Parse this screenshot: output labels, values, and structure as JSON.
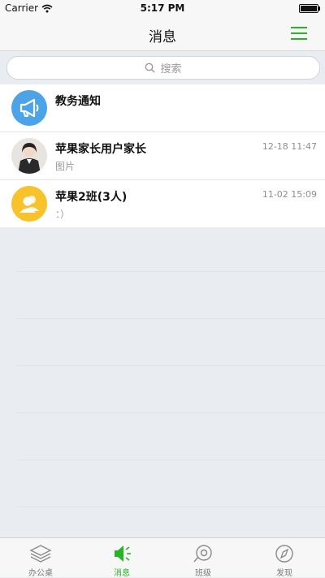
{
  "status_bar": {
    "carrier": "Carrier",
    "time": "5:17 PM"
  },
  "nav": {
    "title": "消息"
  },
  "search": {
    "placeholder": "搜索"
  },
  "messages": [
    {
      "title": "教务通知",
      "subtitle": "",
      "time": "",
      "avatar_icon": "megaphone-icon",
      "avatar_color": "#4da3e8"
    },
    {
      "title": "苹果家长用户家长",
      "subtitle": "图片",
      "time": "12-18 11:47",
      "avatar_icon": "user-photo"
    },
    {
      "title": "苹果2班(3人)",
      "subtitle": "：）",
      "time": "11-02 15:09",
      "avatar_icon": "group-icon",
      "avatar_color": "#f7c22a"
    }
  ],
  "tabs": [
    {
      "label": "办公桌",
      "icon": "layers-icon",
      "active": false
    },
    {
      "label": "消息",
      "icon": "speaker-icon",
      "active": true
    },
    {
      "label": "班级",
      "icon": "class-icon",
      "active": false
    },
    {
      "label": "发现",
      "icon": "compass-icon",
      "active": false
    }
  ],
  "colors": {
    "accent": "#27b427",
    "background": "#e9edf2",
    "notice_blue": "#4da3e8",
    "group_yellow": "#f7c22a"
  }
}
